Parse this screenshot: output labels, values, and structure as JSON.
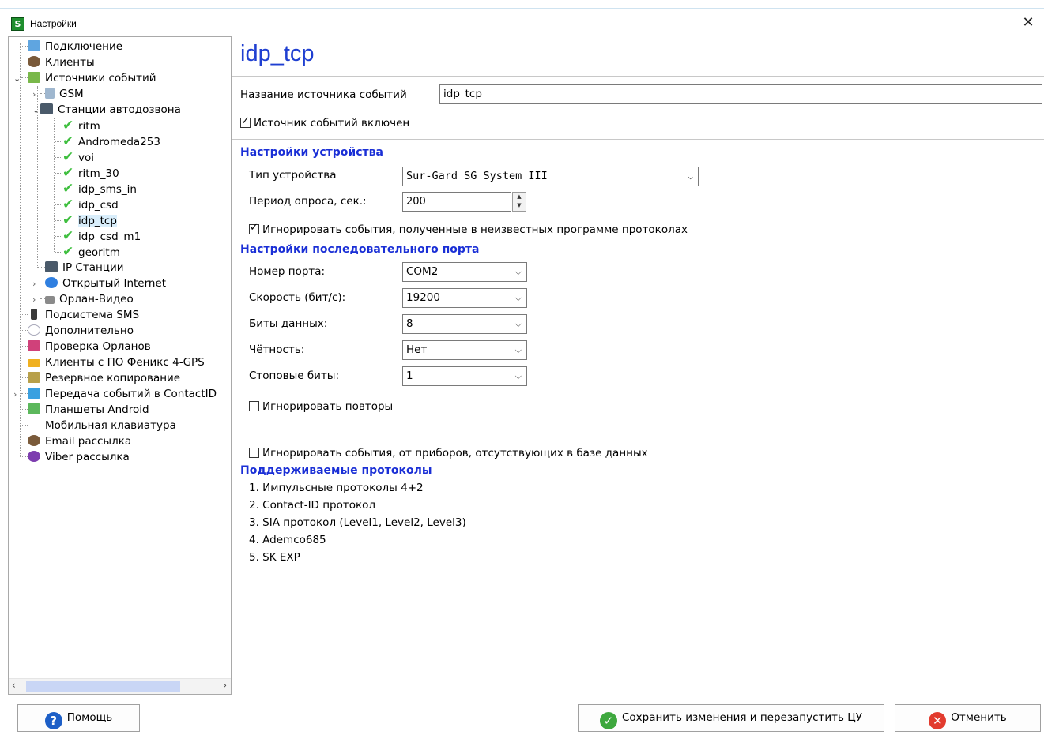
{
  "window": {
    "title": "Настройки"
  },
  "tree": {
    "items": [
      {
        "label": "Подключение"
      },
      {
        "label": "Клиенты"
      },
      {
        "label": "Источники событий"
      },
      {
        "label": "GSM"
      },
      {
        "label": "Станции автодозвона"
      },
      {
        "label": "ritm"
      },
      {
        "label": "Andromeda253"
      },
      {
        "label": "voi"
      },
      {
        "label": "ritm_30"
      },
      {
        "label": "idp_sms_in"
      },
      {
        "label": "idp_csd"
      },
      {
        "label": "idp_tcp"
      },
      {
        "label": "idp_csd_m1"
      },
      {
        "label": "georitm"
      },
      {
        "label": "IP Станции"
      },
      {
        "label": "Открытый Internet"
      },
      {
        "label": "Орлан-Видео"
      },
      {
        "label": "Подсистема SMS"
      },
      {
        "label": "Дополнительно"
      },
      {
        "label": "Проверка Орланов"
      },
      {
        "label": "Клиенты с ПО Феникс 4-GPS"
      },
      {
        "label": "Резервное копирование"
      },
      {
        "label": "Передача событий в ContactID"
      },
      {
        "label": "Планшеты Android"
      },
      {
        "label": "Мобильная клавиатура"
      },
      {
        "label": "Email рассылка"
      },
      {
        "label": "Viber рассылка"
      }
    ]
  },
  "main": {
    "title": "idp_tcp",
    "source_name_label": "Название источника событий",
    "source_name_value": "idp_tcp",
    "source_enabled_label": "Источник событий включен",
    "device_section": "Настройки устройства",
    "device_type_label": "Тип устройства",
    "device_type_value": "Sur-Gard SG System III",
    "poll_period_label": "Период опроса, сек.:",
    "poll_period_value": "200",
    "ignore_unknown_label": "Игнорировать события, полученные в неизвестных программе протоколах",
    "serial_section": "Настройки последовательного порта",
    "port_label": "Номер порта:",
    "port_value": "COM2",
    "baud_label": "Скорость (бит/с):",
    "baud_value": "19200",
    "databits_label": "Биты данных:",
    "databits_value": "8",
    "parity_label": "Чётность:",
    "parity_value": "Нет",
    "stopbits_label": "Стоповые биты:",
    "stopbits_value": "1",
    "ignore_repeats_label": "Игнорировать повторы",
    "ignore_missing_label": "Игнорировать события,  от приборов, отсутствующих в базе  данных",
    "protocols_section": "Поддерживаемые протоколы",
    "protocols": [
      "1. Импульсные протоколы 4+2",
      "2. Contact-ID протокол",
      "3. SIA протокол (Level1, Level2, Level3)",
      "4. Ademco685",
      "5. SK EXP"
    ]
  },
  "buttons": {
    "help": "Помощь",
    "save": "Сохранить изменения и перезапустить ЦУ",
    "cancel": "Отменить"
  }
}
